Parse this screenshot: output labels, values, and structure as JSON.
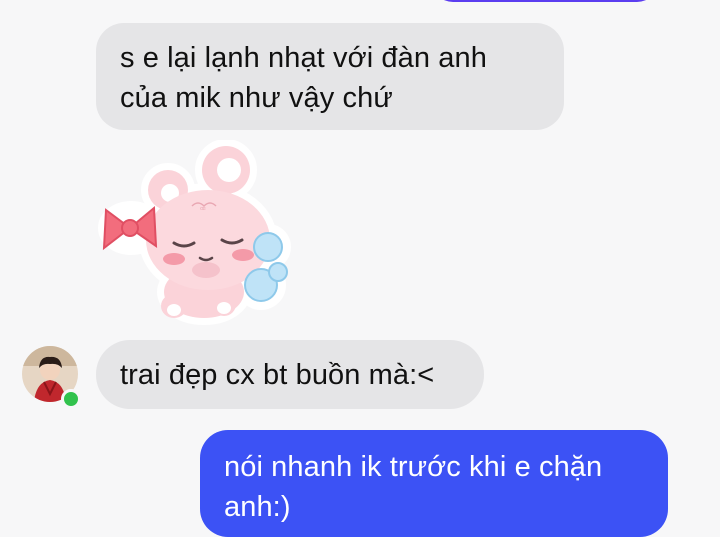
{
  "conversation": {
    "messages": [
      {
        "sender": "other",
        "lines": [
          "s e lại lạnh nhạt với đàn anh",
          "của mik như vậy chứ"
        ]
      },
      {
        "sender": "other",
        "type": "sticker",
        "sticker_icon": "pink-bear-sticker-icon"
      },
      {
        "sender": "other",
        "lines": [
          "trai đẹp cx bt buồn mà:<"
        ]
      },
      {
        "sender": "me",
        "lines": [
          "nói nhanh ik trước khi e chặn",
          "anh:)"
        ]
      }
    ],
    "contact": {
      "avatar_icon": "avatar-icon",
      "status": "online"
    }
  },
  "colors": {
    "incoming_bubble": "#e5e5e7",
    "outgoing_bubble": "#3c52f5",
    "top_partial_bubble": "#5b3df0",
    "online_dot": "#31c24d",
    "background": "#f7f7f8"
  }
}
